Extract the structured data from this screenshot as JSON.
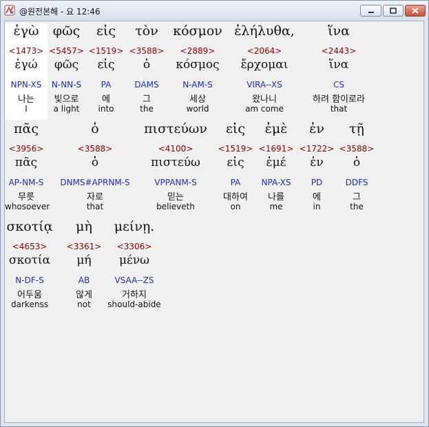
{
  "window": {
    "title": "@원전본해 - 요 12:46"
  },
  "rows": [
    [
      {
        "greek": "ἐγὼ",
        "num": "<1473>",
        "lemma": "ἐγώ",
        "parse": "NPN-XS",
        "kor": "나는",
        "eng": "I"
      },
      {
        "greek": "φῶς",
        "num": "<5457>",
        "lemma": "φῶς",
        "parse": "N-NN-S",
        "kor": "빛으로",
        "eng": "a light"
      },
      {
        "greek": "εἰς",
        "num": "<1519>",
        "lemma": "εἰς",
        "parse": "PA",
        "kor": "에",
        "eng": "into"
      },
      {
        "greek": "τὸν",
        "num": "<3588>",
        "lemma": "ὁ",
        "parse": "DAMS",
        "kor": "그",
        "eng": "the"
      },
      {
        "greek": "κόσμον",
        "num": "<2889>",
        "lemma": "κόσμος",
        "parse": "N-AM-S",
        "kor": "세상",
        "eng": "world"
      },
      {
        "greek": "ἐλήλυθα,",
        "num": "<2064>",
        "lemma": "ἔρχομαι",
        "parse": "VIRA--XS",
        "kor": "왔나니",
        "eng": "am come"
      },
      {
        "greek": "ἵνα",
        "num": "<2443>",
        "lemma": "ἵνα",
        "parse": "CS",
        "kor": "하려 함이로라",
        "eng": "that"
      }
    ],
    [
      {
        "greek": "πᾶς",
        "num": "<3956>",
        "lemma": "πᾶς",
        "parse": "AP-NM-S",
        "kor": "무릇",
        "eng": "whosoever"
      },
      {
        "greek": "ὁ",
        "num": "<3588>",
        "lemma": "ὁ",
        "parse": "DNMS#APRNM-S",
        "kor": "자로",
        "eng": "that"
      },
      {
        "greek": "πιστεύων",
        "num": "<4100>",
        "lemma": "πιστεύω",
        "parse": "VPPANM-S",
        "kor": "믿는",
        "eng": "believeth"
      },
      {
        "greek": "εἰς",
        "num": "<1519>",
        "lemma": "εἰς",
        "parse": "PA",
        "kor": "대하여",
        "eng": "on"
      },
      {
        "greek": "ἐμὲ",
        "num": "<1691>",
        "lemma": "ἐμέ",
        "parse": "NPA-XS",
        "kor": "나를",
        "eng": "me"
      },
      {
        "greek": "ἐν",
        "num": "<1722>",
        "lemma": "ἐν",
        "parse": "PD",
        "kor": "에",
        "eng": "in"
      },
      {
        "greek": "τῇ",
        "num": "<3588>",
        "lemma": "ὁ",
        "parse": "DDFS",
        "kor": "그",
        "eng": "the"
      }
    ],
    [
      {
        "greek": "σκοτίᾳ",
        "num": "<4653>",
        "lemma": "σκοτία",
        "parse": "N-DF-S",
        "kor": "어두움",
        "eng": "darkenss"
      },
      {
        "greek": "μὴ",
        "num": "<3361>",
        "lemma": "μή",
        "parse": "AB",
        "kor": "않게",
        "eng": "not"
      },
      {
        "greek": "μείνῃ.",
        "num": "<3306>",
        "lemma": "μένω",
        "parse": "VSAA--ZS",
        "kor": "거하지",
        "eng": "should-abide"
      }
    ]
  ]
}
